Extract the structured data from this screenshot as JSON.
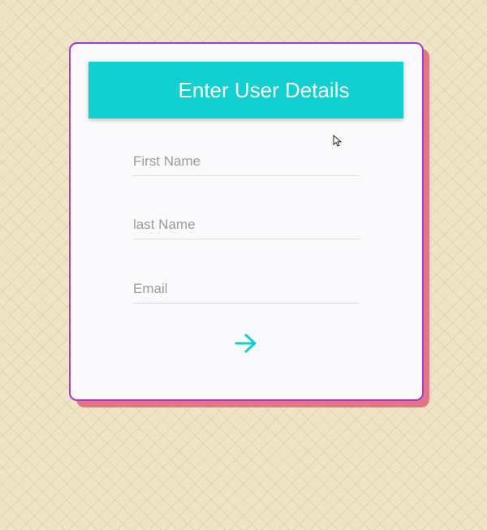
{
  "form": {
    "title": "Enter User Details",
    "fields": [
      {
        "name": "first_name",
        "placeholder": "First Name",
        "value": ""
      },
      {
        "name": "last_name",
        "placeholder": "last Name",
        "value": ""
      },
      {
        "name": "email",
        "placeholder": "Email",
        "value": ""
      }
    ],
    "submit_icon": "arrow-right-icon"
  },
  "colors": {
    "background": "#efe4c6",
    "card": "#faf9fc",
    "card_border": "#9b3fd0",
    "card_shadow": "#e4748a",
    "accent": "#12cfd0",
    "title_text": "#ffffff"
  }
}
